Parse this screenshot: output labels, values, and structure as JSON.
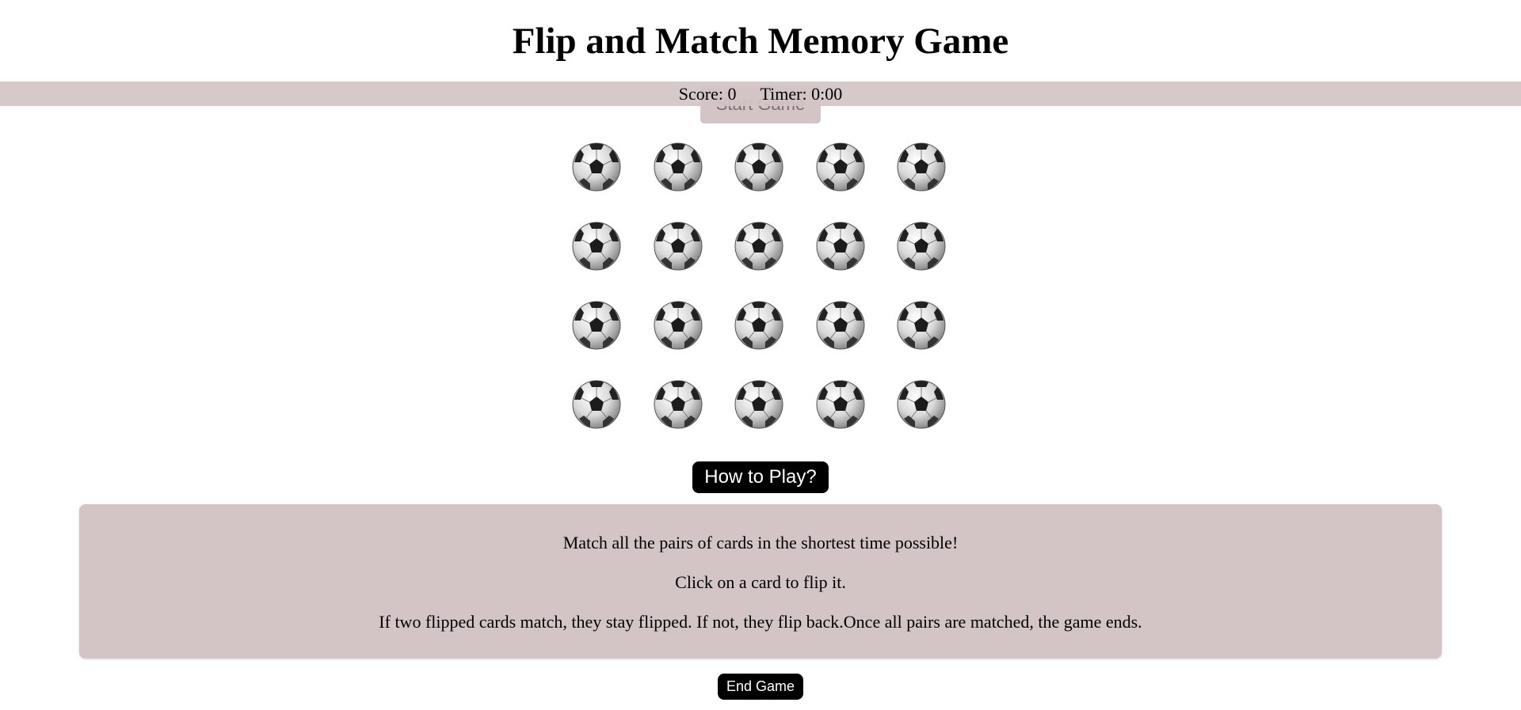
{
  "title": "Flip and Match Memory Game",
  "controls": {
    "start_label": "Start Game",
    "how_to_play_label": "How to Play?",
    "end_label": "End Game"
  },
  "status": {
    "score_label": "Score:",
    "score_value": "0",
    "timer_label": "Timer:",
    "timer_value": "0:00"
  },
  "board": {
    "rows": 4,
    "columns": 5,
    "card_back_icon": "soccer-ball-icon"
  },
  "instructions": {
    "line1": "Match all the pairs of cards in the shortest time possible!",
    "line2": "Click on a card to flip it.",
    "line3": "If two flipped cards match, they stay flipped. If not, they flip back.Once all pairs are matched, the game ends."
  },
  "colors": {
    "panel": "#d3c4c5",
    "button": "#000000"
  }
}
